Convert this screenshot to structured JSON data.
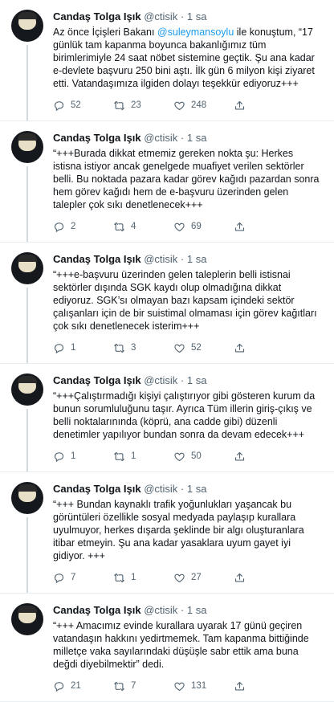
{
  "tweets": [
    {
      "name": "Candaş Tolga Işık",
      "handle": "@ctisik",
      "time": "1 sa",
      "text_before": "Az önce İçişleri Bakanı ",
      "mention": "@suleymansoylu",
      "text_after": " ile konuştum, “17 günlük tam kapanma boyunca bakanlığımız tüm birimlerimiyle 24 saat nöbet sistemine geçtik. Şu ana kadar e-devlete başvuru 250 bini aştı. İlk gün 6 milyon kişi ziyaret etti. Vatandaşımıza ilgiden dolayı teşekkür ediyoruz+++",
      "replies": "52",
      "retweets": "23",
      "likes": "248"
    },
    {
      "name": "Candaş Tolga Işık",
      "handle": "@ctisik",
      "time": "1 sa",
      "text_before": "“+++Burada dikkat etmemiz gereken nokta şu: Herkes istisna istiyor ancak genelgede muafiyet verilen sektörler belli. Bu noktada pazara kadar görev kağıdı pazardan sonra hem görev kağıdı hem de e-başvuru üzerinden gelen talepler çok sıkı denetlenecek+++",
      "mention": "",
      "text_after": "",
      "replies": "2",
      "retweets": "4",
      "likes": "69"
    },
    {
      "name": "Candaş Tolga Işık",
      "handle": "@ctisik",
      "time": "1 sa",
      "text_before": "“+++e-başvuru üzerinden gelen taleplerin belli istisnai sektörler dışında SGK kaydı olup olmadığına dikkat ediyoruz. SGK’sı olmayan bazı kapsam içindeki sektör çalışanları için de bir suistimal olmaması için görev kağıtları çok sıkı denetlenecek isterim+++",
      "mention": "",
      "text_after": "",
      "replies": "1",
      "retweets": "3",
      "likes": "52"
    },
    {
      "name": "Candaş Tolga Işık",
      "handle": "@ctisik",
      "time": "1 sa",
      "text_before": "“+++Çalıştırmadığı kişiyi çalıştırıyor gibi gösteren kurum da bunun sorumluluğunu taşır. Ayrıca Tüm illerin giriş-çıkış ve belli noktalarınında (köprü, ana cadde gibi) düzenli denetimler yapılıyor bundan sonra da devam edecek+++",
      "mention": "",
      "text_after": "",
      "replies": "1",
      "retweets": "1",
      "likes": "50"
    },
    {
      "name": "Candaş Tolga Işık",
      "handle": "@ctisik",
      "time": "1 sa",
      "text_before": "“+++ Bundan kaynaklı trafik yoğunlukları yaşancak bu görüntüleri özellikle sosyal medyada paylaşıp kurallara uyulmuyor, herkes dışarda şeklinde bir algı oluşturanlara itibar etmeyin. Şu ana kadar yasaklara uyum gayet iyi gidiyor. +++",
      "mention": "",
      "text_after": "",
      "replies": "7",
      "retweets": "1",
      "likes": "27"
    },
    {
      "name": "Candaş Tolga Işık",
      "handle": "@ctisik",
      "time": "1 sa",
      "text_before": "“+++ Amacımız evinde kurallara uyarak 17 günü geçiren vatandaşın hakkını yedirtmemek. Tam kapanma bittiğinde milletçe vaka sayılarındaki düşüşle sabr ettik ama buna değdi diyebilmektir” dedi.",
      "mention": "",
      "text_after": "",
      "replies": "21",
      "retweets": "7",
      "likes": "131"
    }
  ]
}
